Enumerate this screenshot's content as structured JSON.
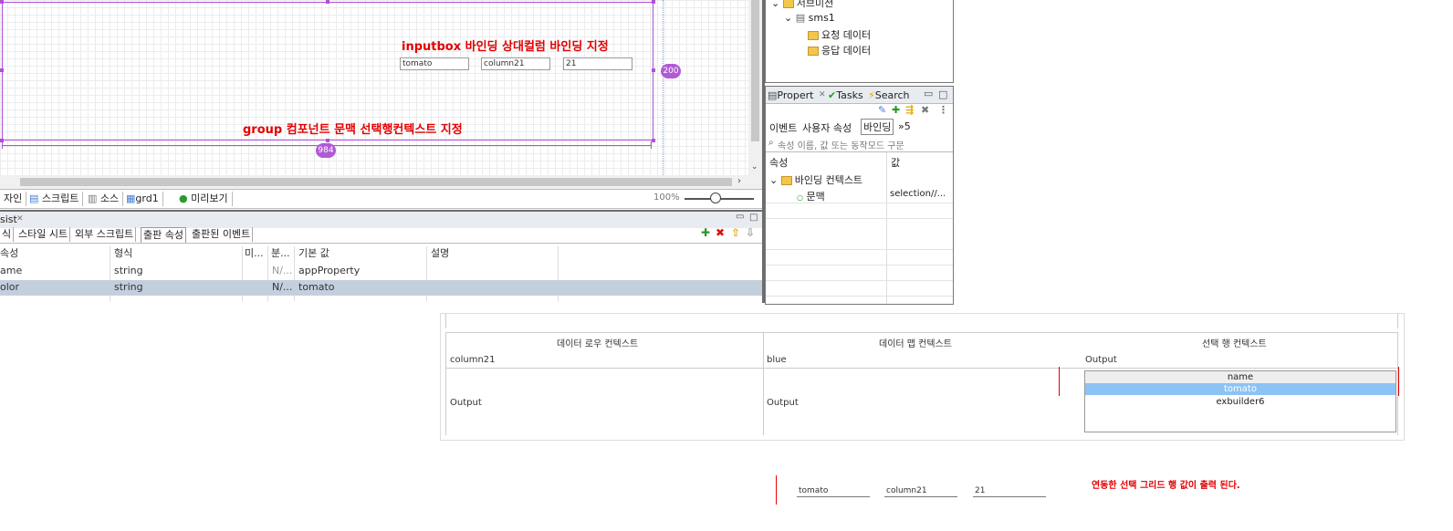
{
  "designer": {
    "note_inputbox": "inputbox 바인딩 상대컬럼 바인딩 지정",
    "note_group": "group 컴포넌트 문맥 선택행컨텍스트 지정",
    "inputs": [
      "tomato",
      "column21",
      "21"
    ],
    "height_badge": "200",
    "width_badge": "984"
  },
  "editor_tabs": [
    "자인",
    "스크립트",
    "소스",
    "grd1",
    "미리보기"
  ],
  "zoom": "100%",
  "prop_list": {
    "title": "sist",
    "tabs": [
      "식",
      "스타일 시트",
      "외부 스크립트",
      "출판 속성",
      "출판된 이벤트"
    ],
    "columns": [
      "속성",
      "형식",
      "미...",
      "분...",
      "기본 값",
      "설명"
    ],
    "rows": [
      {
        "name": "ame",
        "type": "string",
        "c3": "",
        "c4": "N/...",
        "default": "appProperty",
        "desc": ""
      },
      {
        "name": "olor",
        "type": "string",
        "c3": "",
        "c4": "N/...",
        "default": "tomato",
        "desc": ""
      }
    ],
    "colors": {
      "selected_row": "#c3cfdd",
      "add": "#2a9a2a",
      "delete": "#d11",
      "up": "#e0a800"
    }
  },
  "tree": {
    "items": [
      "서브미션",
      "sms1",
      "요청 데이터",
      "응답 데이터"
    ]
  },
  "props_panel": {
    "tabs": [
      "Propert",
      "Tasks",
      "Search"
    ],
    "sub_tabs": [
      "이벤트",
      "사용자 속성",
      "바인딩",
      "»5"
    ],
    "search_placeholder": "속성 이름, 값 또는 동작모드 구문",
    "col_attr": "속성",
    "col_value": "값",
    "binding_context": "바인딩 컨텍스트",
    "row_label": "문맥",
    "row_value": "selection//..."
  },
  "preview": {
    "headers": [
      "데이터 로우 컨텍스트",
      "데이터 맵 컨텍스트",
      "선택 행 컨텍스트"
    ],
    "row1": [
      "column21",
      "blue",
      "Output"
    ],
    "row2": [
      "Output",
      "Output"
    ],
    "list_items": [
      "name",
      "tomato",
      "exbuilder6"
    ],
    "selected_color": "#8cc3f5"
  },
  "output": {
    "inputs": [
      "tomato",
      "column21",
      "21"
    ],
    "note": "연동한 선택 그리드 행 값이 출력 된다."
  }
}
